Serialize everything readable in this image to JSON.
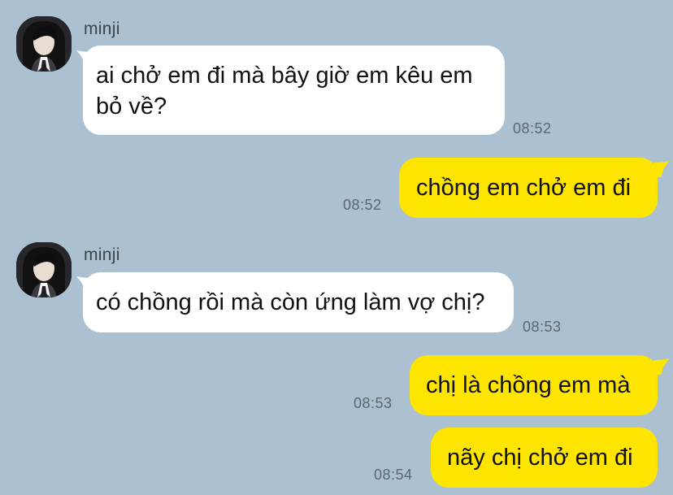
{
  "chat": {
    "messages": [
      {
        "sender": "minji",
        "text": "ai chở em đi mà bây giờ em kêu em bỏ về?",
        "time": "08:52"
      },
      {
        "sender": "",
        "text": "chồng em chở em đi",
        "time": "08:52"
      },
      {
        "sender": "minji",
        "text": "có chồng rồi mà còn ứng làm vợ chị?",
        "time": "08:53"
      },
      {
        "sender": "",
        "text": "chị là chồng em mà",
        "time": "08:53"
      },
      {
        "sender": "",
        "text": "nãy chị chở em đi",
        "time": "08:54"
      }
    ]
  },
  "colors": {
    "background": "#abc1d1",
    "incoming_bubble": "#ffffff",
    "outgoing_bubble": "#fee500",
    "timestamp": "#5b6670"
  }
}
